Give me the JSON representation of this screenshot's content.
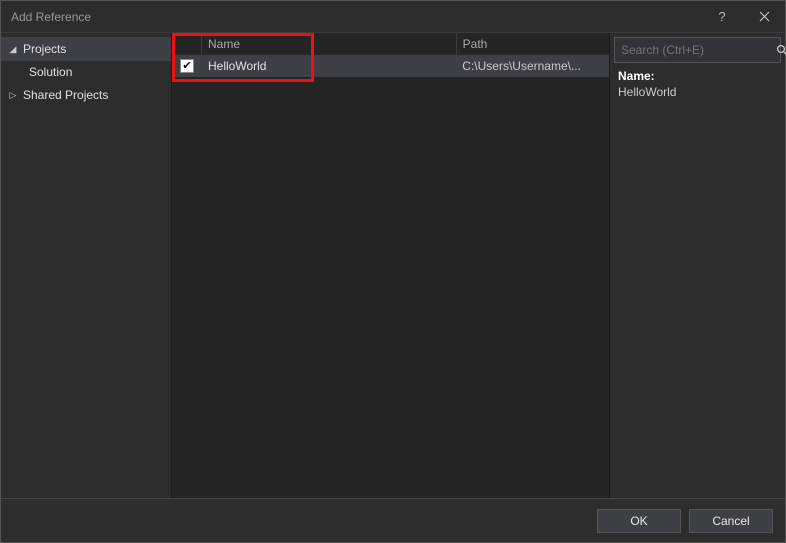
{
  "title": "Add Reference",
  "sidebar": {
    "items": [
      {
        "label": "Projects",
        "expanded": true,
        "children": [
          {
            "label": "Solution"
          }
        ]
      },
      {
        "label": "Shared Projects",
        "expanded": false,
        "children": []
      }
    ]
  },
  "list": {
    "columns": {
      "name": "Name",
      "path": "Path"
    },
    "rows": [
      {
        "checked": true,
        "name": "HelloWorld",
        "path": "C:\\Users\\Username\\..."
      }
    ]
  },
  "search": {
    "placeholder": "Search (Ctrl+E)"
  },
  "details": {
    "name_label": "Name:",
    "name_value": "HelloWorld"
  },
  "footer": {
    "ok": "OK",
    "cancel": "Cancel"
  }
}
